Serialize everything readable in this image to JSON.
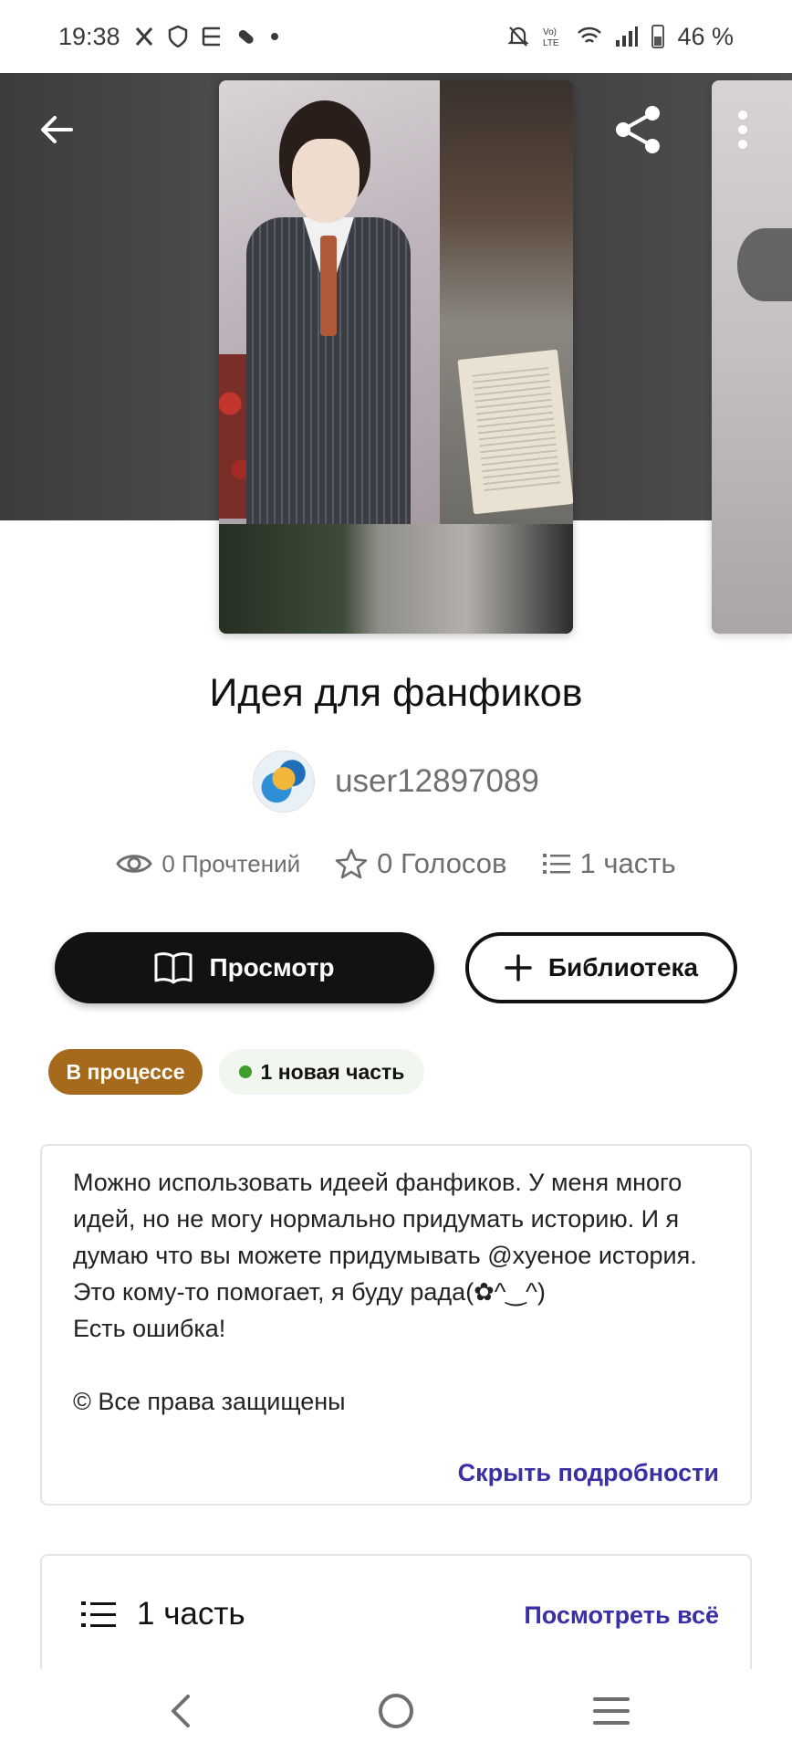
{
  "status_bar": {
    "time": "19:38",
    "battery": "46 %",
    "left_icons": [
      "x-icon",
      "shield-icon",
      "bracket-icon",
      "pill-icon",
      "dot-icon"
    ],
    "right_icons": [
      "mute-icon",
      "volte-icon",
      "wifi-icon",
      "signal-icon",
      "battery-icon"
    ]
  },
  "story": {
    "title": "Идея для фанфиков",
    "author": "user12897089",
    "stats": {
      "reads": "0 Прочтений",
      "votes": "0 Голосов",
      "parts": "1 часть"
    }
  },
  "actions": {
    "read_label": "Просмотр",
    "library_label": "Библиотека"
  },
  "badges": {
    "status": "В процессе",
    "new_part": "1 новая часть"
  },
  "description": {
    "text": "Можно использовать идеей фанфиков. У меня много идей, но не могу нормально придумать историю. И я думаю что вы можете придумывать @хуеное история. Это кому-то помогает, я буду рада(✿^‿^)\nЕсть ошибка!",
    "copyright": "© Все права защищены",
    "hide_link": "Скрыть подробности"
  },
  "parts_section": {
    "title": "1 часть",
    "view_all": "Посмотреть всё"
  },
  "colors": {
    "accent": "#3a2fa4",
    "status_badge": "#a56a1c",
    "new_dot": "#3f9d2a",
    "primary_button": "#121212"
  }
}
